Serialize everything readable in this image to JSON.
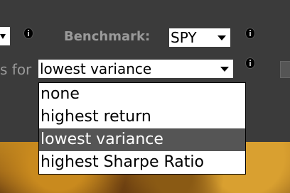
{
  "row1": {
    "left_select_value": "",
    "benchmark_label": "Benchmark:",
    "benchmark_value": "SPY"
  },
  "row2": {
    "label": "s for",
    "optimize_value": "lowest variance"
  },
  "dropdown": {
    "options": [
      "none",
      "highest return",
      "lowest variance",
      "highest Sharpe Ratio"
    ],
    "selected": "lowest variance"
  },
  "icons": [
    "info-icon",
    "info-icon",
    "info-icon",
    "chevron-down-icon"
  ]
}
